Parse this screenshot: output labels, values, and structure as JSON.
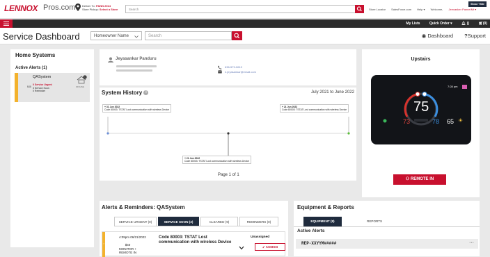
{
  "header": {
    "logo": "LENNOX",
    "logo_suffix": "Pros.com",
    "deliver_label": "Deliver To:",
    "deliver_value": "PANN 2014",
    "store_label": "Store Pickup:",
    "store_value": "Select a Store",
    "search_placeholder": "Search",
    "links": [
      "Store Locator",
      "SalesForce.com",
      "Help ▾",
      "Welcome,"
    ],
    "user_name": "Jeevanker Panne/Mt ▾",
    "show_hide": "Show / Hide"
  },
  "navbar": {
    "my_lists": "My Lists",
    "quick_order": "Quick Order",
    "notifications": "()",
    "cart": "(0)"
  },
  "subheader": {
    "title": "Service Dashboard",
    "select_value": "Homeowner Name",
    "search_placeholder": "Search",
    "dashboard_link": "Dashboard",
    "support_link": "Support"
  },
  "home_systems": {
    "title": "Home Systems",
    "active_alerts": "Active Alerts (1)",
    "system_name": "QASystem",
    "price": "$48",
    "service_urgent": "0 Service Urgent",
    "service_soon": "3 Service Soon",
    "reminder": "0 Reminder",
    "offline_label": "OFFLINE"
  },
  "owner": {
    "name": "Jeyasankar Panduru",
    "phone": "636-579-0619",
    "email": "e.jeyasankar@email.com"
  },
  "history": {
    "title": "System History",
    "range": "July 2021 to June 2022",
    "events": [
      {
        "date": "+ 31 Jun 2022",
        "text": "Code 80003: TSTAT Lost communication with wireless Device"
      },
      {
        "date": "+ 21 Jun 2022",
        "text": "Code 80003: TSTAT Lost communication with wireless Device"
      },
      {
        "date": "+ 21 Jun 2022",
        "text": "Code 80003: TSTAT Lost communication with wireless Device"
      }
    ],
    "page": "Page 1 of 1"
  },
  "thermostat": {
    "title": "Upstairs",
    "temperature": "75",
    "heat_set": "73",
    "cool_set": "78",
    "outside": "65",
    "time": "7:28 pm",
    "remote_button": "REMOTE IN"
  },
  "alerts": {
    "title": "Alerts & Reminders: QASystem",
    "tabs": [
      "SERVICE URGENT (0)",
      "SERVICE SOON (3)",
      "CLEARED (9)",
      "REMINDERS (0)"
    ],
    "item": {
      "time": "4:09pm 06/21/2022",
      "price": "$40",
      "monitor": "MONITOR +",
      "remote": "REMOTE IN",
      "code": "Code 80003: TSTAT Lost communication with wireless Device",
      "status": "Unassigned",
      "assign": "ASSIGN"
    }
  },
  "equipment": {
    "title": "Equipment & Reports",
    "tab_equipment": "EQUIPMENT (8)",
    "tab_reports": "REPORTS",
    "active_alerts": "Active Alerts",
    "device": "REP-XXYYM#####"
  }
}
